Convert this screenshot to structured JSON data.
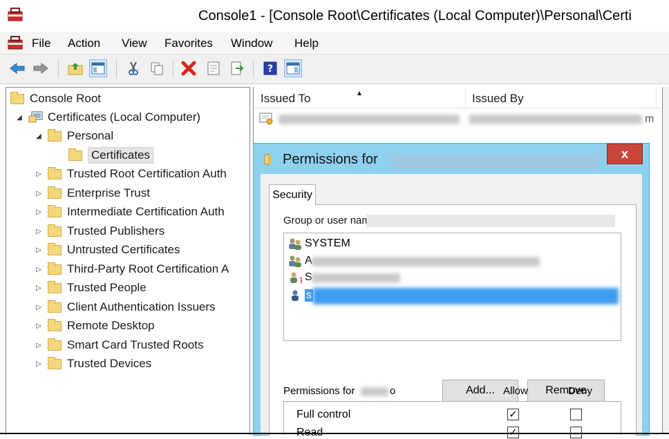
{
  "window": {
    "title": "Console1 - [Console Root\\Certificates (Local Computer)\\Personal\\Certi"
  },
  "menu": [
    "File",
    "Action",
    "View",
    "Favorites",
    "Window",
    "Help"
  ],
  "toolbar_icons": [
    "back-arrow-icon",
    "forward-arrow-icon",
    "up-folder-icon",
    "show-hide-tree-icon",
    "cut-icon",
    "copy-icon",
    "delete-icon",
    "properties-icon",
    "export-icon",
    "help-icon",
    "action-pane-icon"
  ],
  "tree": {
    "root": "Console Root",
    "computer": "Certificates (Local Computer)",
    "personal": "Personal",
    "certificates": "Certificates",
    "stores": [
      "Trusted Root Certification Auth",
      "Enterprise Trust",
      "Intermediate Certification Auth",
      "Trusted Publishers",
      "Untrusted Certificates",
      "Third-Party Root Certification A",
      "Trusted People",
      "Client Authentication Issuers",
      "Remote Desktop",
      "Smart Card Trusted Roots",
      "Trusted Devices"
    ]
  },
  "list": {
    "col_issued_to": "Issued To",
    "col_issued_by": "Issued By",
    "row_suffix": "m"
  },
  "dialog": {
    "title": "Permissions for",
    "close": "x",
    "tab": "Security",
    "group_label": "Group or user names:",
    "users": [
      "SYSTEM",
      "A",
      "S",
      "s"
    ],
    "add_button": "Add...",
    "remove_button": "Remove",
    "permissions_label": "Permissions for",
    "permissions_suffix": "o",
    "allow_label": "Allow",
    "deny_label": "Deny",
    "permissions": [
      {
        "name": "Full control",
        "allow": true,
        "deny": false
      },
      {
        "name": "Read",
        "allow": true,
        "deny": false
      }
    ]
  },
  "colors": {
    "dialog_frame": "#8fd0ef",
    "close_button": "#c7463a",
    "selection": "#3c9cf0",
    "folder": "#f5d77b"
  }
}
